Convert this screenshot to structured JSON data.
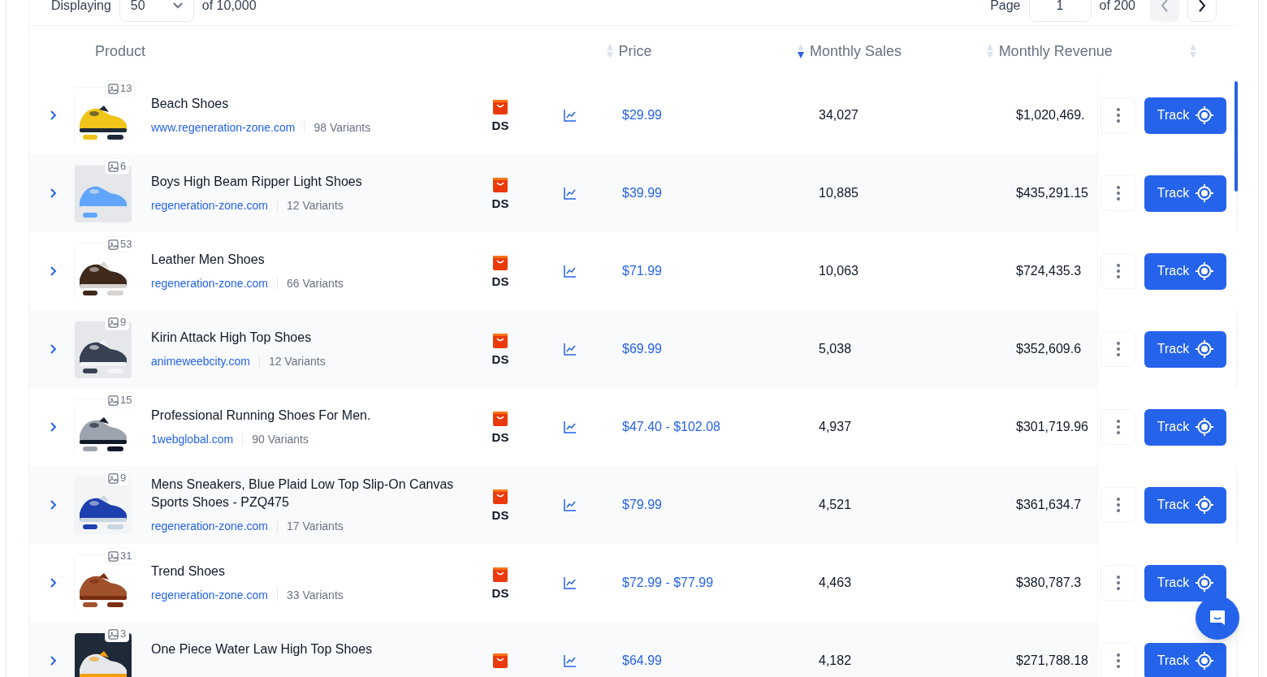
{
  "pagination": {
    "displaying_label": "Displaying",
    "page_size": "50",
    "total": "of 10,000",
    "page_label": "Page",
    "page": "1",
    "page_total": "of 200",
    "prev_disabled": true,
    "next_disabled": false
  },
  "columns": [
    {
      "label": "Product"
    },
    {
      "label": "Price",
      "sorted": false
    },
    {
      "label": "Monthly Sales",
      "sorted": true
    },
    {
      "label": "Monthly Revenue",
      "sorted": false
    },
    {
      "sorted": false
    }
  ],
  "rows": [
    {
      "expanded": false,
      "image_count": "13",
      "title": "Beach Shoes",
      "site": "www.regeneration-zone.com",
      "variants": "98 Variants",
      "store_badge": "DS",
      "price": "$29.99",
      "sales": "34,027",
      "revenue": "$1,020,469.",
      "track": "Track"
    },
    {
      "expanded": false,
      "image_count": "6",
      "title": "Boys High Beam Ripper Light Shoes",
      "site": "regeneration-zone.com",
      "variants": "12 Variants",
      "store_badge": "DS",
      "price": "$39.99",
      "sales": "10,885",
      "revenue": "$435,291.15",
      "track": "Track"
    },
    {
      "expanded": false,
      "image_count": "53",
      "title": "Leather Men Shoes",
      "site": "regeneration-zone.com",
      "variants": "66 Variants",
      "store_badge": "DS",
      "price": "$71.99",
      "sales": "10,063",
      "revenue": "$724,435.3",
      "track": "Track"
    },
    {
      "expanded": false,
      "image_count": "9",
      "title": "Kirin Attack High Top Shoes",
      "site": "animeweebcity.com",
      "variants": "12 Variants",
      "store_badge": "DS",
      "price": "$69.99",
      "sales": "5,038",
      "revenue": "$352,609.6",
      "track": "Track"
    },
    {
      "expanded": false,
      "image_count": "15",
      "title": "Professional Running Shoes For Men.",
      "site": "1webglobal.com",
      "variants": "90 Variants",
      "store_badge": "DS",
      "price": "$47.40 - $102.08",
      "sales": "4,937",
      "revenue": "$301,719.96",
      "track": "Track"
    },
    {
      "expanded": false,
      "image_count": "9",
      "title": "Mens Sneakers, Blue Plaid Low Top Slip-On Canvas Sports Shoes - PZQ475",
      "site": "regeneration-zone.com",
      "variants": "17 Variants",
      "store_badge": "DS",
      "price": "$79.99",
      "sales": "4,521",
      "revenue": "$361,634.7",
      "track": "Track"
    },
    {
      "expanded": false,
      "image_count": "31",
      "title": "Trend Shoes",
      "site": "regeneration-zone.com",
      "variants": "33 Variants",
      "store_badge": "DS",
      "price": "$72.99 - $77.99",
      "sales": "4,463",
      "revenue": "$380,787.3",
      "track": "Track"
    },
    {
      "expanded": false,
      "image_count": "3",
      "title": "One Piece Water Law High Top Shoes",
      "price": "$64.99",
      "sales": "4,182",
      "revenue": "$271,788.18",
      "track": "Track"
    }
  ]
}
